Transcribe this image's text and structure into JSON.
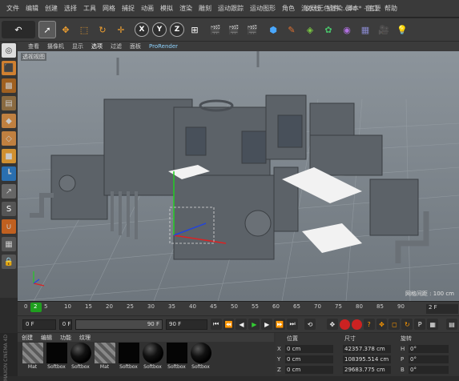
{
  "menu": [
    "文件",
    "编辑",
    "创建",
    "选择",
    "工具",
    "网格",
    "捕捉",
    "动画",
    "模拟",
    "渲染",
    "雕刻",
    "运动跟踪",
    "运动图形",
    "角色",
    "流水线",
    "插件",
    "脚本",
    "窗口",
    "帮助"
  ],
  "window_title": "家居无色渲染.c4d * - 主要",
  "viewport_menu": [
    "查看",
    "摄像机",
    "显示",
    "选项",
    "过滤",
    "面板",
    "ProRender"
  ],
  "viewport_label": "透视视图",
  "grid_label": "网格间距 : 100 cm",
  "timeline": {
    "ticks": [
      "0",
      "2",
      "5",
      "10",
      "15",
      "20",
      "25",
      "30",
      "35",
      "40",
      "45",
      "50",
      "55",
      "60",
      "65",
      "70",
      "75",
      "80",
      "85",
      "90"
    ],
    "current": "2 F"
  },
  "transport": {
    "start": "0 F",
    "current_field": "0 F",
    "range_end": "90 F",
    "end": "90 F"
  },
  "material_tabs": [
    "创建",
    "编辑",
    "功能",
    "纹理"
  ],
  "materials": [
    {
      "name": "Mat",
      "type": "check"
    },
    {
      "name": "Softbox",
      "type": "black"
    },
    {
      "name": "Softbox",
      "type": "sphere"
    },
    {
      "name": "Mat",
      "type": "check"
    },
    {
      "name": "Softbox",
      "type": "black"
    },
    {
      "name": "Softbox",
      "type": "sphere"
    },
    {
      "name": "Softbox",
      "type": "black"
    },
    {
      "name": "Softbox",
      "type": "sphere"
    }
  ],
  "coords": {
    "headers": [
      "位置",
      "尺寸",
      "旋转"
    ],
    "rows": [
      {
        "axis": "X",
        "pos": "0 cm",
        "size": "42357.378 cm",
        "rot_axis": "H",
        "rot": "0°"
      },
      {
        "axis": "Y",
        "pos": "0 cm",
        "size": "108395.514 cm",
        "rot_axis": "P",
        "rot": "0°"
      },
      {
        "axis": "Z",
        "pos": "0 cm",
        "size": "29683.775 cm",
        "rot_axis": "B",
        "rot": "0°"
      }
    ]
  },
  "logo_text": "MAXON CINEMA 4D",
  "colors": {
    "accent": "#f0a030",
    "playhead": "#1f9f1f",
    "record": "#cc2222",
    "prorender": "#8fd3ff"
  }
}
